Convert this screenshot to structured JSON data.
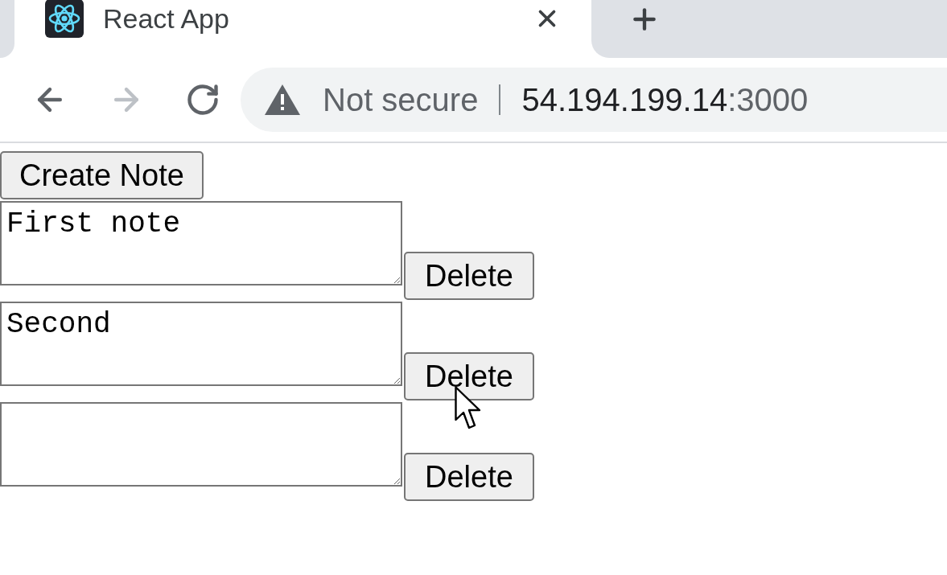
{
  "browser": {
    "tabs": [
      {
        "title": "React App",
        "selected": true
      }
    ],
    "nav_buttons": [
      {
        "kind": "back",
        "disabled": false
      },
      {
        "kind": "forward",
        "disabled": true
      },
      {
        "kind": "reload",
        "disabled": false
      }
    ],
    "address_bar": {
      "security_label": "Not secure",
      "host": "54.194.199.14",
      "port": ":3000"
    }
  },
  "page": {
    "create_button": "Create Note",
    "notes": [
      {
        "value": "First note",
        "delete_label": "Delete"
      },
      {
        "value": "Second",
        "delete_label": "Delete"
      },
      {
        "delete_label": "Delete"
      }
    ]
  }
}
